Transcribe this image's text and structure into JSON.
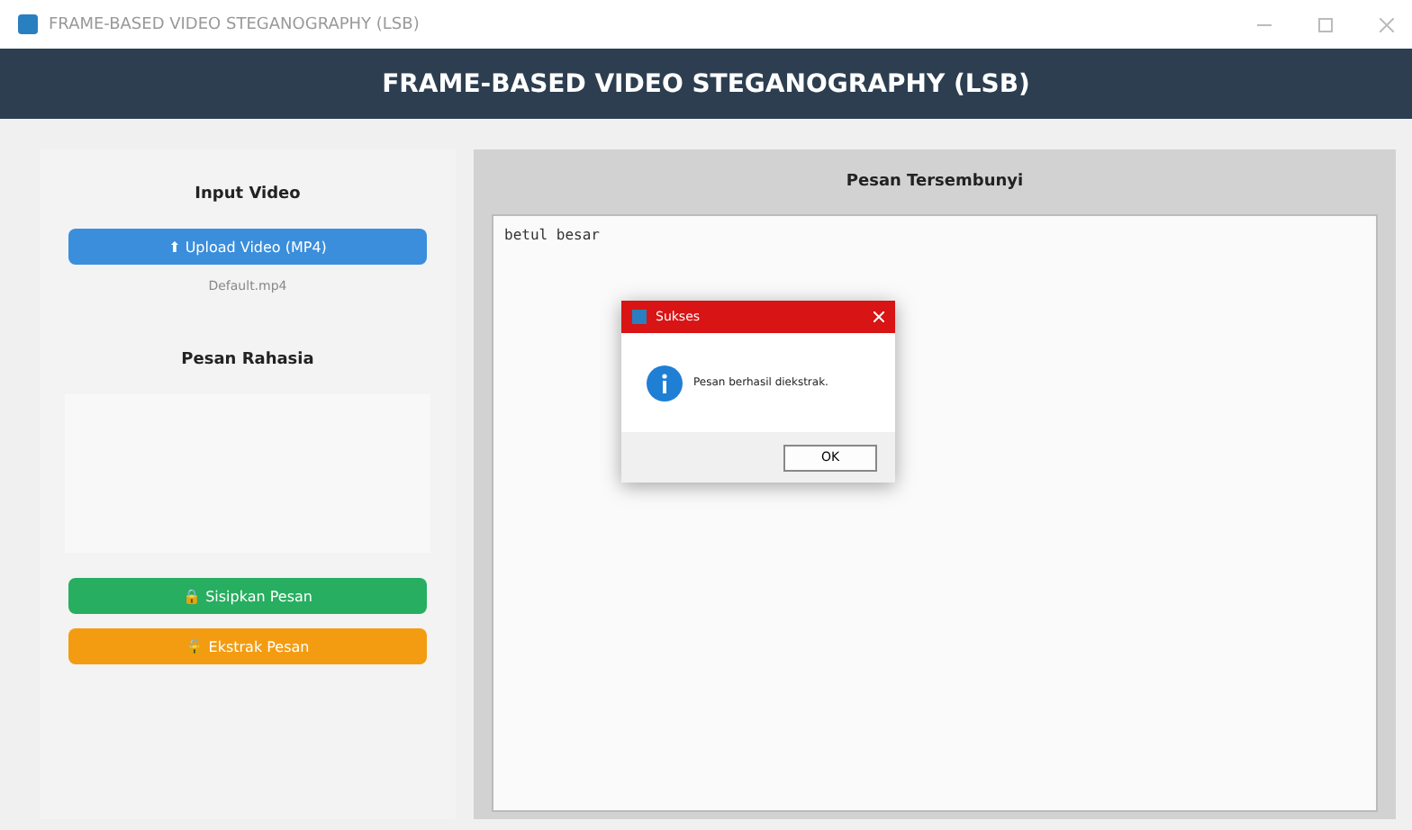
{
  "window": {
    "title": "FRAME-BASED VIDEO STEGANOGRAPHY (LSB)"
  },
  "header": {
    "title": "FRAME-BASED VIDEO STEGANOGRAPHY (LSB)"
  },
  "left_panel": {
    "input_heading": "Input Video",
    "upload_button": "⬆ Upload Video (MP4)",
    "file_label": "Default.mp4",
    "message_heading": "Pesan Rahasia",
    "buttons": [
      {
        "label": "🔒 Sisipkan Pesan",
        "kind": "embed"
      },
      {
        "label": "🔓 Ekstrak Pesan",
        "kind": "extract"
      }
    ]
  },
  "right_panel": {
    "heading": "Pesan Tersembunyi",
    "content": "betul besar"
  },
  "dialog": {
    "title": "Sukses",
    "message": "Pesan berhasil diekstrak.",
    "button": "OK"
  }
}
